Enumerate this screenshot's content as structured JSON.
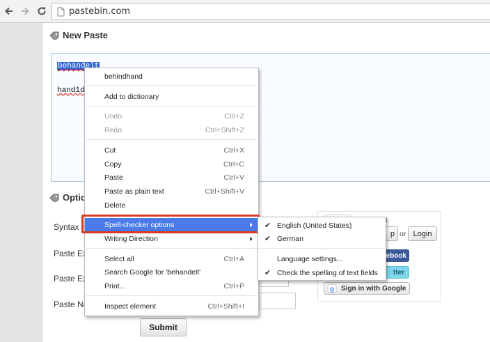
{
  "browser": {
    "url": "pastebin.com"
  },
  "page": {
    "new_paste_title": "New Paste",
    "options_title": "Optio",
    "paste_lines": [
      "behandelt",
      "hand1d"
    ],
    "fields": [
      {
        "label": "Syntax H"
      },
      {
        "label": "Paste Exp"
      },
      {
        "label": "Paste Exp"
      },
      {
        "label": "Paste Na"
      }
    ],
    "submit_label": "Submit",
    "guest": {
      "heading_partial": "uest",
      "signup_partial": "p",
      "or_text": "or",
      "login_label": "Login",
      "facebook_partial": "ebook",
      "twitter_partial": "tter",
      "google_label": "Sign in with Google"
    }
  },
  "context_menu": {
    "items": [
      {
        "label": "behindhand",
        "shortcut": "",
        "disabled": false
      },
      {
        "label": "Add to dictionary",
        "shortcut": "",
        "disabled": false
      },
      {
        "label": "Undo",
        "shortcut": "Ctrl+Z",
        "disabled": true
      },
      {
        "label": "Redo",
        "shortcut": "Ctrl+Shift+Z",
        "disabled": true
      },
      {
        "label": "Cut",
        "shortcut": "Ctrl+X",
        "disabled": false
      },
      {
        "label": "Copy",
        "shortcut": "Ctrl+C",
        "disabled": false
      },
      {
        "label": "Paste",
        "shortcut": "Ctrl+V",
        "disabled": false
      },
      {
        "label": "Paste as plain text",
        "shortcut": "Ctrl+Shift+V",
        "disabled": false
      },
      {
        "label": "Delete",
        "shortcut": "",
        "disabled": false
      },
      {
        "label": "Spell-checker options",
        "shortcut": "",
        "disabled": false
      },
      {
        "label": "Writing Direction",
        "shortcut": "",
        "disabled": false
      },
      {
        "label": "Select all",
        "shortcut": "Ctrl+A",
        "disabled": false
      },
      {
        "label": "Search Google for 'behandelt'",
        "shortcut": "",
        "disabled": false
      },
      {
        "label": "Print...",
        "shortcut": "Ctrl+P",
        "disabled": false
      },
      {
        "label": "Inspect element",
        "shortcut": "Ctrl+Shift+I",
        "disabled": false
      }
    ],
    "highlight_color": "#4a7be8",
    "outline_color": "#d93a25"
  },
  "submenu": {
    "items": [
      {
        "label": "English (United States)",
        "checked": true
      },
      {
        "label": "German",
        "checked": true
      },
      {
        "label": "Language settings...",
        "checked": false
      },
      {
        "label": "Check the spelling of text fields",
        "checked": true
      }
    ]
  }
}
